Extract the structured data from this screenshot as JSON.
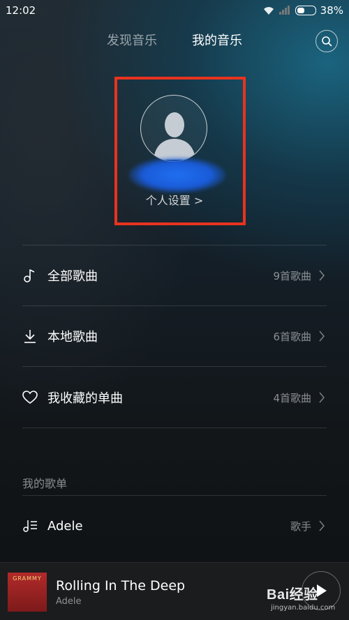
{
  "status_bar": {
    "time": "12:02",
    "battery": "38%"
  },
  "tabs": [
    {
      "label": "发现音乐",
      "active": false
    },
    {
      "label": "我的音乐",
      "active": true
    }
  ],
  "profile": {
    "settings_label": "个人设置 >"
  },
  "music_items": [
    {
      "icon": "music-note-icon",
      "label": "全部歌曲",
      "count": "9首歌曲"
    },
    {
      "icon": "download-icon",
      "label": "本地歌曲",
      "count": "6首歌曲"
    },
    {
      "icon": "heart-icon",
      "label": "我收藏的单曲",
      "count": "4首歌曲"
    }
  ],
  "playlists_section": {
    "title": "我的歌单",
    "items": [
      {
        "icon": "playlist-icon",
        "label": "Adele",
        "meta": "歌手"
      }
    ]
  },
  "now_playing": {
    "album_text": "GRAMMY",
    "title": "Rolling In The Deep",
    "artist": "Adele"
  },
  "watermark": {
    "text": "Bai经验",
    "sub": "jingyan.baidu.com"
  },
  "colors": {
    "highlight": "#e8331f",
    "accent_blue": "#1f6ff0"
  }
}
